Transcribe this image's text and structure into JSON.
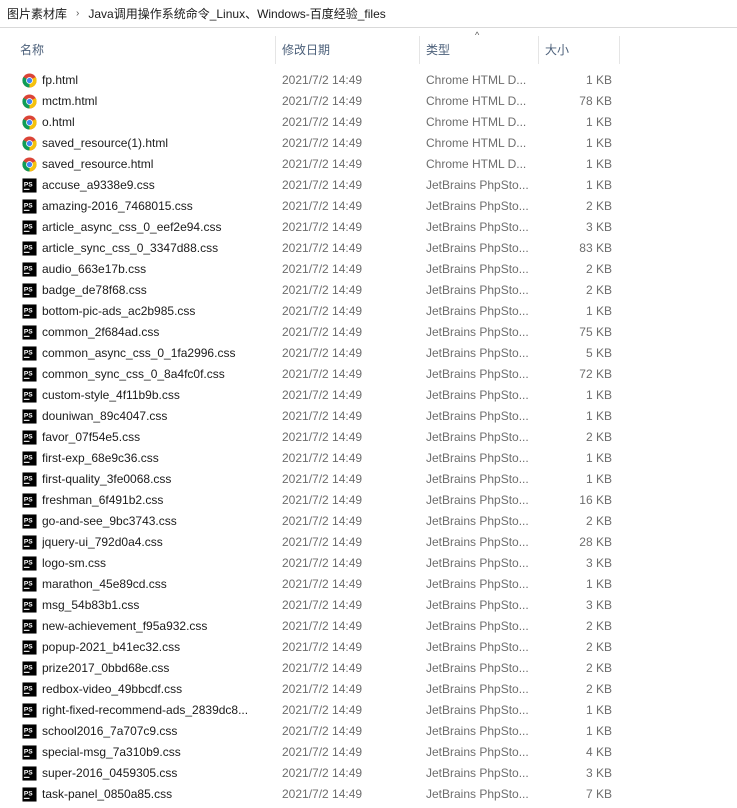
{
  "breadcrumb": {
    "items": [
      "图片素材库",
      "Java调用操作系统命令_Linux、Windows-百度经验_files"
    ],
    "separator": "›"
  },
  "columns": {
    "name": "名称",
    "date": "修改日期",
    "type": "类型",
    "size": "大小",
    "sort_indicator": "^"
  },
  "icons": {
    "html": "chrome-icon",
    "css": "phpstorm-icon"
  },
  "colors": {
    "header_text": "#4c607a",
    "meta_text": "#6d6d6d",
    "ps_icon_bg": "#000000"
  },
  "files": [
    {
      "name": "fp.html",
      "date": "2021/7/2 14:49",
      "type": "Chrome HTML D...",
      "size": "1 KB",
      "icon": "html"
    },
    {
      "name": "mctm.html",
      "date": "2021/7/2 14:49",
      "type": "Chrome HTML D...",
      "size": "78 KB",
      "icon": "html"
    },
    {
      "name": "o.html",
      "date": "2021/7/2 14:49",
      "type": "Chrome HTML D...",
      "size": "1 KB",
      "icon": "html"
    },
    {
      "name": "saved_resource(1).html",
      "date": "2021/7/2 14:49",
      "type": "Chrome HTML D...",
      "size": "1 KB",
      "icon": "html"
    },
    {
      "name": "saved_resource.html",
      "date": "2021/7/2 14:49",
      "type": "Chrome HTML D...",
      "size": "1 KB",
      "icon": "html"
    },
    {
      "name": "accuse_a9338e9.css",
      "date": "2021/7/2 14:49",
      "type": "JetBrains PhpSto...",
      "size": "1 KB",
      "icon": "css"
    },
    {
      "name": "amazing-2016_7468015.css",
      "date": "2021/7/2 14:49",
      "type": "JetBrains PhpSto...",
      "size": "2 KB",
      "icon": "css"
    },
    {
      "name": "article_async_css_0_eef2e94.css",
      "date": "2021/7/2 14:49",
      "type": "JetBrains PhpSto...",
      "size": "3 KB",
      "icon": "css"
    },
    {
      "name": "article_sync_css_0_3347d88.css",
      "date": "2021/7/2 14:49",
      "type": "JetBrains PhpSto...",
      "size": "83 KB",
      "icon": "css"
    },
    {
      "name": "audio_663e17b.css",
      "date": "2021/7/2 14:49",
      "type": "JetBrains PhpSto...",
      "size": "2 KB",
      "icon": "css"
    },
    {
      "name": "badge_de78f68.css",
      "date": "2021/7/2 14:49",
      "type": "JetBrains PhpSto...",
      "size": "2 KB",
      "icon": "css"
    },
    {
      "name": "bottom-pic-ads_ac2b985.css",
      "date": "2021/7/2 14:49",
      "type": "JetBrains PhpSto...",
      "size": "1 KB",
      "icon": "css"
    },
    {
      "name": "common_2f684ad.css",
      "date": "2021/7/2 14:49",
      "type": "JetBrains PhpSto...",
      "size": "75 KB",
      "icon": "css"
    },
    {
      "name": "common_async_css_0_1fa2996.css",
      "date": "2021/7/2 14:49",
      "type": "JetBrains PhpSto...",
      "size": "5 KB",
      "icon": "css"
    },
    {
      "name": "common_sync_css_0_8a4fc0f.css",
      "date": "2021/7/2 14:49",
      "type": "JetBrains PhpSto...",
      "size": "72 KB",
      "icon": "css"
    },
    {
      "name": "custom-style_4f11b9b.css",
      "date": "2021/7/2 14:49",
      "type": "JetBrains PhpSto...",
      "size": "1 KB",
      "icon": "css"
    },
    {
      "name": "douniwan_89c4047.css",
      "date": "2021/7/2 14:49",
      "type": "JetBrains PhpSto...",
      "size": "1 KB",
      "icon": "css"
    },
    {
      "name": "favor_07f54e5.css",
      "date": "2021/7/2 14:49",
      "type": "JetBrains PhpSto...",
      "size": "2 KB",
      "icon": "css"
    },
    {
      "name": "first-exp_68e9c36.css",
      "date": "2021/7/2 14:49",
      "type": "JetBrains PhpSto...",
      "size": "1 KB",
      "icon": "css"
    },
    {
      "name": "first-quality_3fe0068.css",
      "date": "2021/7/2 14:49",
      "type": "JetBrains PhpSto...",
      "size": "1 KB",
      "icon": "css"
    },
    {
      "name": "freshman_6f491b2.css",
      "date": "2021/7/2 14:49",
      "type": "JetBrains PhpSto...",
      "size": "16 KB",
      "icon": "css"
    },
    {
      "name": "go-and-see_9bc3743.css",
      "date": "2021/7/2 14:49",
      "type": "JetBrains PhpSto...",
      "size": "2 KB",
      "icon": "css"
    },
    {
      "name": "jquery-ui_792d0a4.css",
      "date": "2021/7/2 14:49",
      "type": "JetBrains PhpSto...",
      "size": "28 KB",
      "icon": "css"
    },
    {
      "name": "logo-sm.css",
      "date": "2021/7/2 14:49",
      "type": "JetBrains PhpSto...",
      "size": "3 KB",
      "icon": "css"
    },
    {
      "name": "marathon_45e89cd.css",
      "date": "2021/7/2 14:49",
      "type": "JetBrains PhpSto...",
      "size": "1 KB",
      "icon": "css"
    },
    {
      "name": "msg_54b83b1.css",
      "date": "2021/7/2 14:49",
      "type": "JetBrains PhpSto...",
      "size": "3 KB",
      "icon": "css"
    },
    {
      "name": "new-achievement_f95a932.css",
      "date": "2021/7/2 14:49",
      "type": "JetBrains PhpSto...",
      "size": "2 KB",
      "icon": "css"
    },
    {
      "name": "popup-2021_b41ec32.css",
      "date": "2021/7/2 14:49",
      "type": "JetBrains PhpSto...",
      "size": "2 KB",
      "icon": "css"
    },
    {
      "name": "prize2017_0bbd68e.css",
      "date": "2021/7/2 14:49",
      "type": "JetBrains PhpSto...",
      "size": "2 KB",
      "icon": "css"
    },
    {
      "name": "redbox-video_49bbcdf.css",
      "date": "2021/7/2 14:49",
      "type": "JetBrains PhpSto...",
      "size": "2 KB",
      "icon": "css"
    },
    {
      "name": "right-fixed-recommend-ads_2839dc8...",
      "date": "2021/7/2 14:49",
      "type": "JetBrains PhpSto...",
      "size": "1 KB",
      "icon": "css"
    },
    {
      "name": "school2016_7a707c9.css",
      "date": "2021/7/2 14:49",
      "type": "JetBrains PhpSto...",
      "size": "1 KB",
      "icon": "css"
    },
    {
      "name": "special-msg_7a310b9.css",
      "date": "2021/7/2 14:49",
      "type": "JetBrains PhpSto...",
      "size": "4 KB",
      "icon": "css"
    },
    {
      "name": "super-2016_0459305.css",
      "date": "2021/7/2 14:49",
      "type": "JetBrains PhpSto...",
      "size": "3 KB",
      "icon": "css"
    },
    {
      "name": "task-panel_0850a85.css",
      "date": "2021/7/2 14:49",
      "type": "JetBrains PhpSto...",
      "size": "7 KB",
      "icon": "css"
    }
  ]
}
